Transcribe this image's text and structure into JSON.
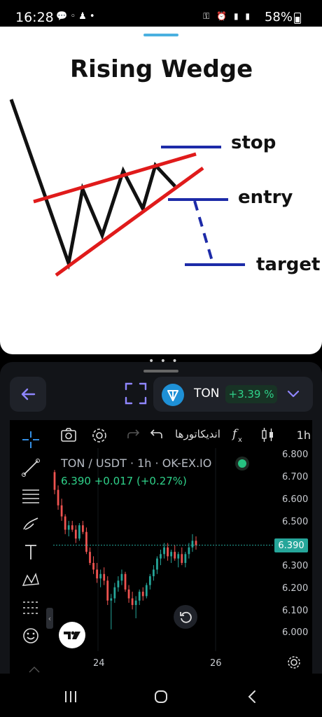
{
  "status_bar": {
    "time": "16:28",
    "battery": "58%",
    "left_icons": [
      "chat-icon",
      "okx-icon",
      "app-icon",
      "dot-icon"
    ],
    "right_icons": [
      "key-icon",
      "alarm-icon",
      "4g-signal-icon",
      "signal-icon"
    ]
  },
  "image": {
    "title": "Rising Wedge",
    "labels": {
      "stop": "stop",
      "entry": "entry",
      "target": "target"
    }
  },
  "header": {
    "symbol": "TON",
    "change": "+3.39 %",
    "accent": "#7b6cf6",
    "positive_color": "#2fd28a"
  },
  "chart_toolbar": {
    "indicators_label": "اندیکاتورها",
    "timeframe": "1h"
  },
  "chart": {
    "title": "TON / USDT · 1h · OK-EX.IO",
    "last_price": "6.390",
    "change_abs": "+0.017",
    "change_pct": "(+0.27%)",
    "values_line": "6.390 +0.017 (+0.27%)",
    "price_ticks": [
      "6.800",
      "6.700",
      "6.600",
      "6.500",
      "6.400",
      "6.300",
      "6.200",
      "6.100",
      "6.000"
    ],
    "time_ticks": [
      "24",
      "26"
    ],
    "current_price_tag": "6.390"
  },
  "chart_data": {
    "type": "candlestick",
    "title": "TON / USDT · 1h · OK-EX.IO",
    "ylim": [
      6.0,
      6.8
    ],
    "x_ticks": [
      "24",
      "26"
    ],
    "last": 6.39,
    "ohlc": [
      [
        6.72,
        6.73,
        6.62,
        6.64
      ],
      [
        6.64,
        6.66,
        6.55,
        6.57
      ],
      [
        6.57,
        6.6,
        6.5,
        6.52
      ],
      [
        6.52,
        6.53,
        6.44,
        6.46
      ],
      [
        6.46,
        6.5,
        6.43,
        6.48
      ],
      [
        6.48,
        6.5,
        6.45,
        6.46
      ],
      [
        6.46,
        6.48,
        6.4,
        6.42
      ],
      [
        6.42,
        6.49,
        6.41,
        6.48
      ],
      [
        6.48,
        6.5,
        6.44,
        6.45
      ],
      [
        6.45,
        6.47,
        6.35,
        6.36
      ],
      [
        6.36,
        6.38,
        6.3,
        6.31
      ],
      [
        6.31,
        6.34,
        6.26,
        6.28
      ],
      [
        6.28,
        6.31,
        6.22,
        6.24
      ],
      [
        6.24,
        6.28,
        6.2,
        6.26
      ],
      [
        6.26,
        6.29,
        6.21,
        6.23
      ],
      [
        6.23,
        6.25,
        6.12,
        6.14
      ],
      [
        6.14,
        6.17,
        6.01,
        6.15
      ],
      [
        6.15,
        6.22,
        6.13,
        6.2
      ],
      [
        6.2,
        6.25,
        6.18,
        6.23
      ],
      [
        6.23,
        6.28,
        6.21,
        6.26
      ],
      [
        6.26,
        6.27,
        6.18,
        6.19
      ],
      [
        6.19,
        6.21,
        6.13,
        6.15
      ],
      [
        6.15,
        6.18,
        6.1,
        6.12
      ],
      [
        6.12,
        6.16,
        6.06,
        6.14
      ],
      [
        6.14,
        6.19,
        6.12,
        6.18
      ],
      [
        6.18,
        6.2,
        6.14,
        6.16
      ],
      [
        6.16,
        6.22,
        6.15,
        6.21
      ],
      [
        6.21,
        6.26,
        6.19,
        6.25
      ],
      [
        6.25,
        6.3,
        6.23,
        6.28
      ],
      [
        6.28,
        6.34,
        6.26,
        6.33
      ],
      [
        6.33,
        6.37,
        6.3,
        6.35
      ],
      [
        6.35,
        6.4,
        6.33,
        6.38
      ],
      [
        6.38,
        6.4,
        6.32,
        6.34
      ],
      [
        6.34,
        6.37,
        6.31,
        6.36
      ],
      [
        6.36,
        6.39,
        6.32,
        6.33
      ],
      [
        6.33,
        6.36,
        6.29,
        6.35
      ],
      [
        6.35,
        6.38,
        6.3,
        6.31
      ],
      [
        6.31,
        6.36,
        6.29,
        6.35
      ],
      [
        6.35,
        6.4,
        6.33,
        6.38
      ],
      [
        6.38,
        6.44,
        6.36,
        6.41
      ],
      [
        6.41,
        6.43,
        6.37,
        6.39
      ]
    ]
  },
  "colors": {
    "up": "#26a69a",
    "down": "#ef5350",
    "background": "#000000",
    "panel": "#1f2229"
  }
}
